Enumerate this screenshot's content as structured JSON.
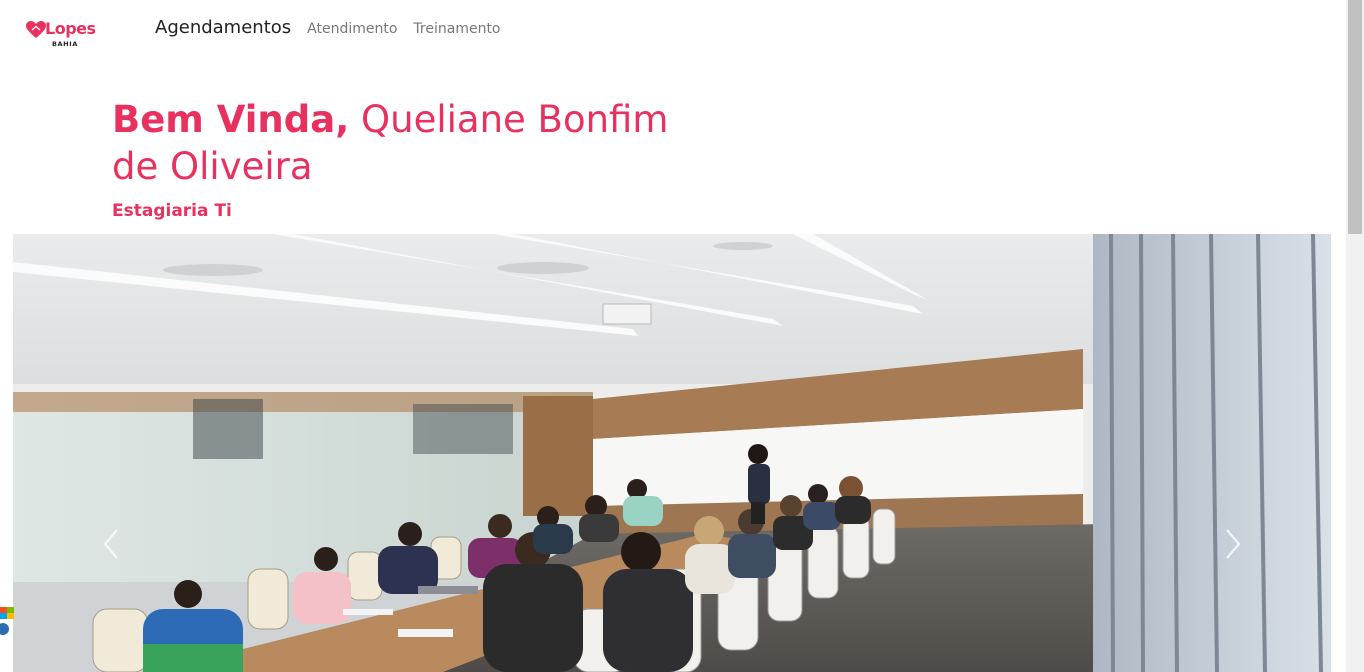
{
  "brand": {
    "name": "Lopes",
    "subtitle": "BAHIA",
    "logo_icon": "heart-icon",
    "accent_color": "#e8315f"
  },
  "nav": {
    "items": [
      {
        "label": "Agendamentos",
        "active": true
      },
      {
        "label": "Atendimento",
        "active": false
      },
      {
        "label": "Treinamento",
        "active": false
      }
    ]
  },
  "greeting": {
    "prefix": "Bem Vinda,",
    "name": "Queliane Bonfim de Oliveira",
    "role": "Estagiaria Ti"
  },
  "carousel": {
    "prev_icon": "chevron-left-icon",
    "next_icon": "chevron-right-icon"
  }
}
